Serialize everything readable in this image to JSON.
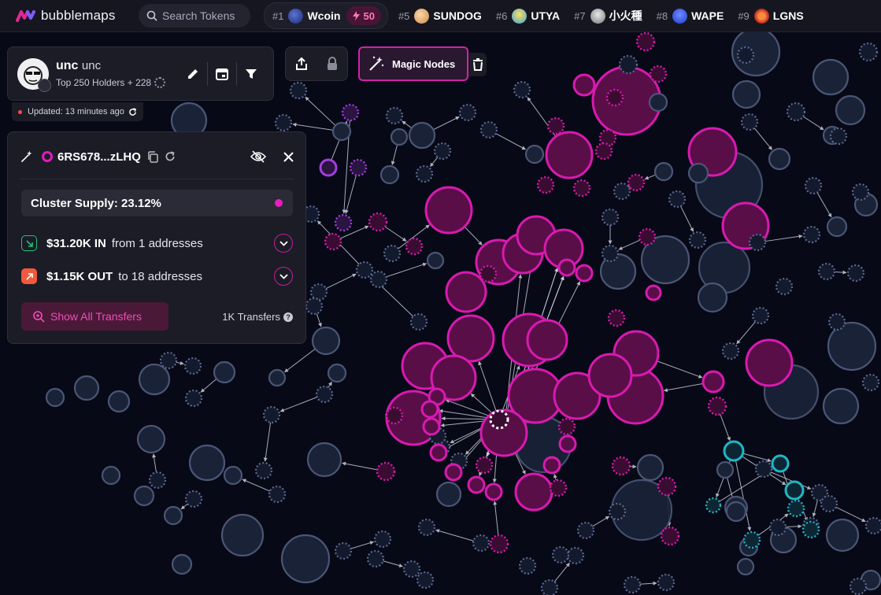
{
  "app": {
    "name": "bubblemaps"
  },
  "search": {
    "placeholder": "Search Tokens"
  },
  "ticker": [
    {
      "rank": "#1",
      "name": "Wcoin",
      "hot_count": "50"
    },
    {
      "rank": "#5",
      "name": "SUNDOG"
    },
    {
      "rank": "#6",
      "name": "UTYA"
    },
    {
      "rank": "#7",
      "name": "小火種"
    },
    {
      "rank": "#8",
      "name": "WAPE"
    },
    {
      "rank": "#9",
      "name": "LGNS"
    }
  ],
  "holders_panel": {
    "name_bold": "unc",
    "name": "unc",
    "subtitle": "Top 250 Holders + 228"
  },
  "updated": {
    "text": "Updated: 13 minutes ago"
  },
  "toolbar": {
    "magic_label": "Magic Nodes"
  },
  "cluster": {
    "address": "6RS678...zLHQ",
    "supply": "Cluster Supply: 23.12%",
    "in_amount": "$31.20K IN",
    "in_desc": "from 1 addresses",
    "out_amount": "$1.15K OUT",
    "out_desc": "to 18 addresses",
    "show_all": "Show All Transfers",
    "transfers": "1K Transfers"
  },
  "colors": {
    "accent": "#e21bbd",
    "node_pink": "#d81ab0",
    "node_navy": "#1a2238",
    "node_cyan": "#1fb6c9",
    "node_purple": "#a23ee0"
  }
}
